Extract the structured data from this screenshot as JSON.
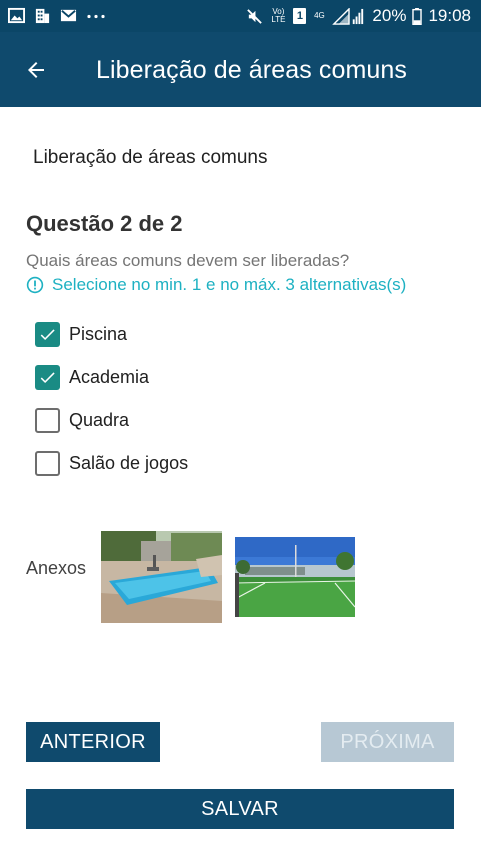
{
  "status_bar": {
    "icons_left": [
      "image-icon",
      "building-icon",
      "mail-icon",
      "more-dots-icon"
    ],
    "icons_right": [
      "mute-icon",
      "volte-icon",
      "sim-icon",
      "network-4g-icon",
      "signal-icon"
    ],
    "volte_label": "Vo)\nLTE",
    "sim_label": "1",
    "net_label": "4G",
    "battery": "20%",
    "time": "19:08"
  },
  "appbar": {
    "title": "Liberação de áreas comuns",
    "back_icon": "arrow-left-icon"
  },
  "form": {
    "subtitle": "Liberação de áreas comuns",
    "question_title": "Questão 2 de 2",
    "question_text": "Quais áreas comuns devem ser liberadas?",
    "hint": "Selecione no min. 1 e no máx. 3 alternativas(s)",
    "options": [
      {
        "label": "Piscina",
        "checked": true
      },
      {
        "label": "Academia",
        "checked": true
      },
      {
        "label": "Quadra",
        "checked": false
      },
      {
        "label": "Salão de jogos",
        "checked": false
      }
    ],
    "attachments_label": "Anexos",
    "attachments": [
      "pool-photo",
      "sports-field-photo"
    ]
  },
  "buttons": {
    "previous": "ANTERIOR",
    "next": "PRÓXIMA",
    "save": "SALVAR"
  },
  "colors": {
    "primary": "#0f4a6d",
    "status_bar": "#0b4667",
    "check_fill": "#1a8b84",
    "hint": "#1eb1c2",
    "disabled_button": "#b7c8d4"
  }
}
